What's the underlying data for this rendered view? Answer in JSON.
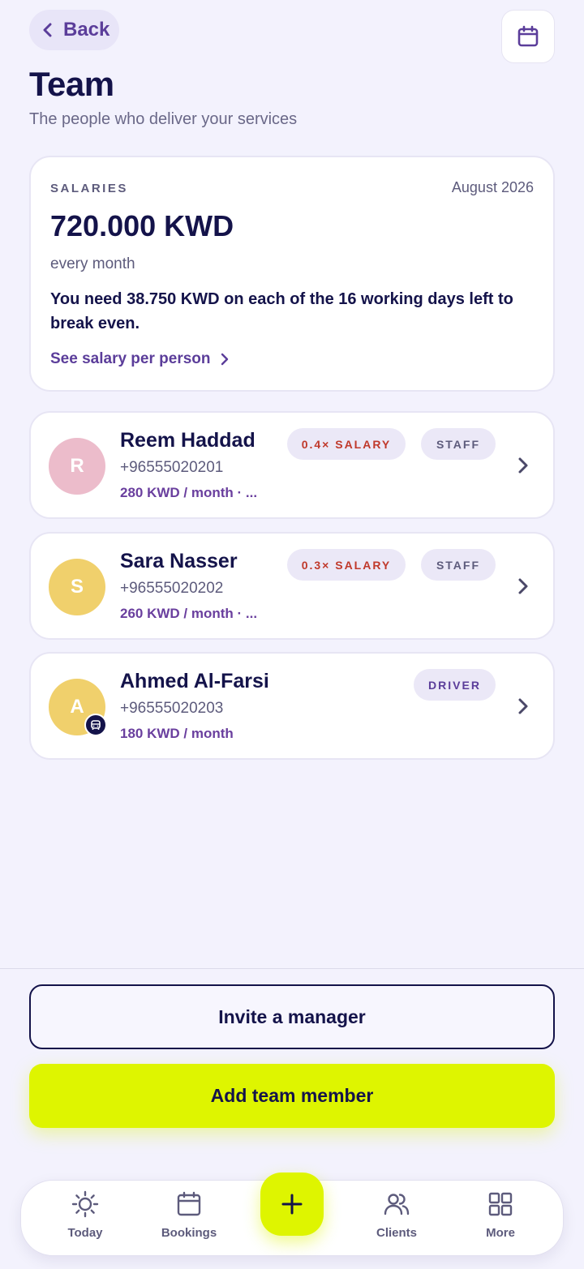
{
  "header": {
    "back_label": "Back",
    "title": "Team",
    "subtitle": "The people who deliver your services"
  },
  "salary_card": {
    "label": "SALARIES",
    "month": "August 2026",
    "amount": "720.000 KWD",
    "period": "every month",
    "note": "You need 38.750 KWD on each of the 16 working days left to break even.",
    "link_label": "See salary per person"
  },
  "members": [
    {
      "initial": "R",
      "name": "Reem Haddad",
      "phone": "+96555020201",
      "pay": "280 KWD / month · ...",
      "salary_chip": "0.4× SALARY",
      "role_chip": "STAFF",
      "avatar_color": "#ecbccb"
    },
    {
      "initial": "S",
      "name": "Sara Nasser",
      "phone": "+96555020202",
      "pay": "260 KWD / month · ...",
      "salary_chip": "0.3× SALARY",
      "role_chip": "STAFF",
      "avatar_color": "#f0d06c"
    },
    {
      "initial": "A",
      "name": "Ahmed Al-Farsi",
      "phone": "+96555020203",
      "pay": "180 KWD / month",
      "role_chip": "DRIVER",
      "avatar_color": "#f0d06c",
      "badge_icon": "car-icon"
    }
  ],
  "actions": {
    "invite_label": "Invite a manager",
    "add_label": "Add team member"
  },
  "nav": {
    "items": [
      {
        "label": "Today",
        "icon": "sun-icon"
      },
      {
        "label": "Bookings",
        "icon": "calendar-icon"
      },
      {
        "label": "Clients",
        "icon": "users-icon"
      },
      {
        "label": "More",
        "icon": "grid-icon"
      }
    ],
    "fab_icon": "plus-icon"
  },
  "colors": {
    "background": "#f3f2fd",
    "accent": "#def500",
    "brand_purple": "#5b3d9a",
    "text_dark": "#14134a",
    "salary_chip_text": "#c0392b"
  }
}
